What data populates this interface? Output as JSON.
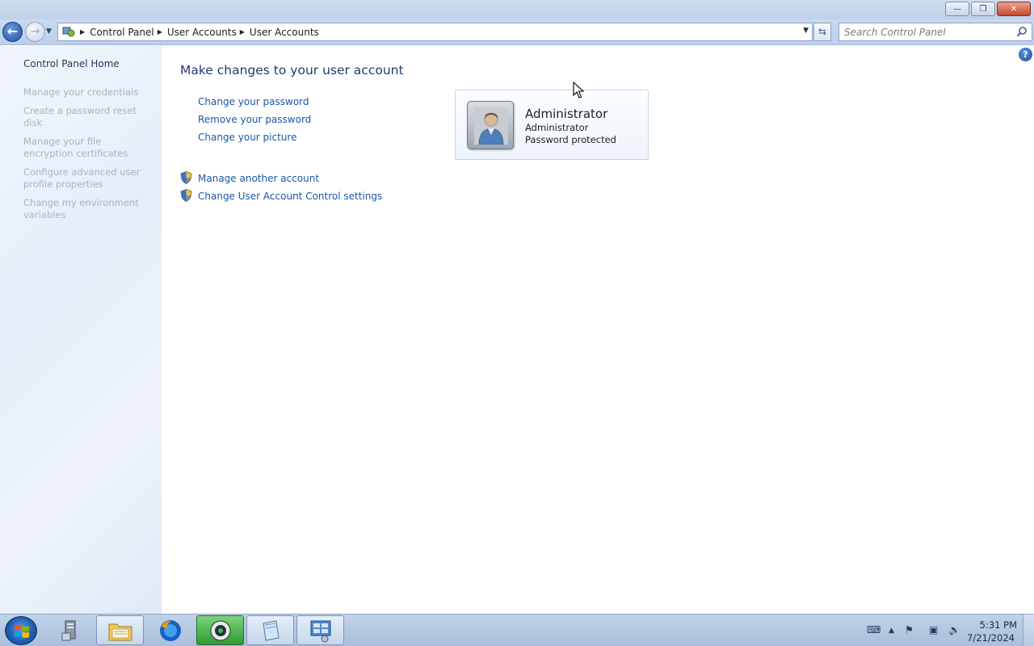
{
  "window": {
    "minimize_label": "—",
    "maximize_label": "❐",
    "close_label": "✕"
  },
  "nav": {
    "back_glyph": "←",
    "forward_glyph": "→",
    "breadcrumbs": [
      "Control Panel",
      "User Accounts",
      "User Accounts"
    ],
    "search_placeholder": "Search Control Panel"
  },
  "sidebar": {
    "home_label": "Control Panel Home",
    "tasks": [
      "Manage your credentials",
      "Create a password reset disk",
      "Manage your file encryption certificates",
      "Configure advanced user profile properties",
      "Change my environment variables"
    ]
  },
  "main": {
    "title": "Make changes to your user account",
    "links": [
      "Change your password",
      "Remove your password",
      "Change your picture"
    ],
    "admin_links": [
      "Manage another account",
      "Change User Account Control settings"
    ],
    "account": {
      "name": "Administrator",
      "type": "Administrator",
      "status": "Password protected"
    },
    "help_glyph": "?"
  },
  "taskbar": {
    "clock_time": "5:31 PM",
    "clock_date": "7/21/2024",
    "items": [
      "server-manager",
      "file-explorer",
      "firefox",
      "media-app",
      "notepad-app",
      "control-panel"
    ],
    "active_item": "control-panel"
  },
  "colors": {
    "link": "#1a56a8",
    "title": "#1e3a6e",
    "disabled": "#a7b3c2"
  }
}
